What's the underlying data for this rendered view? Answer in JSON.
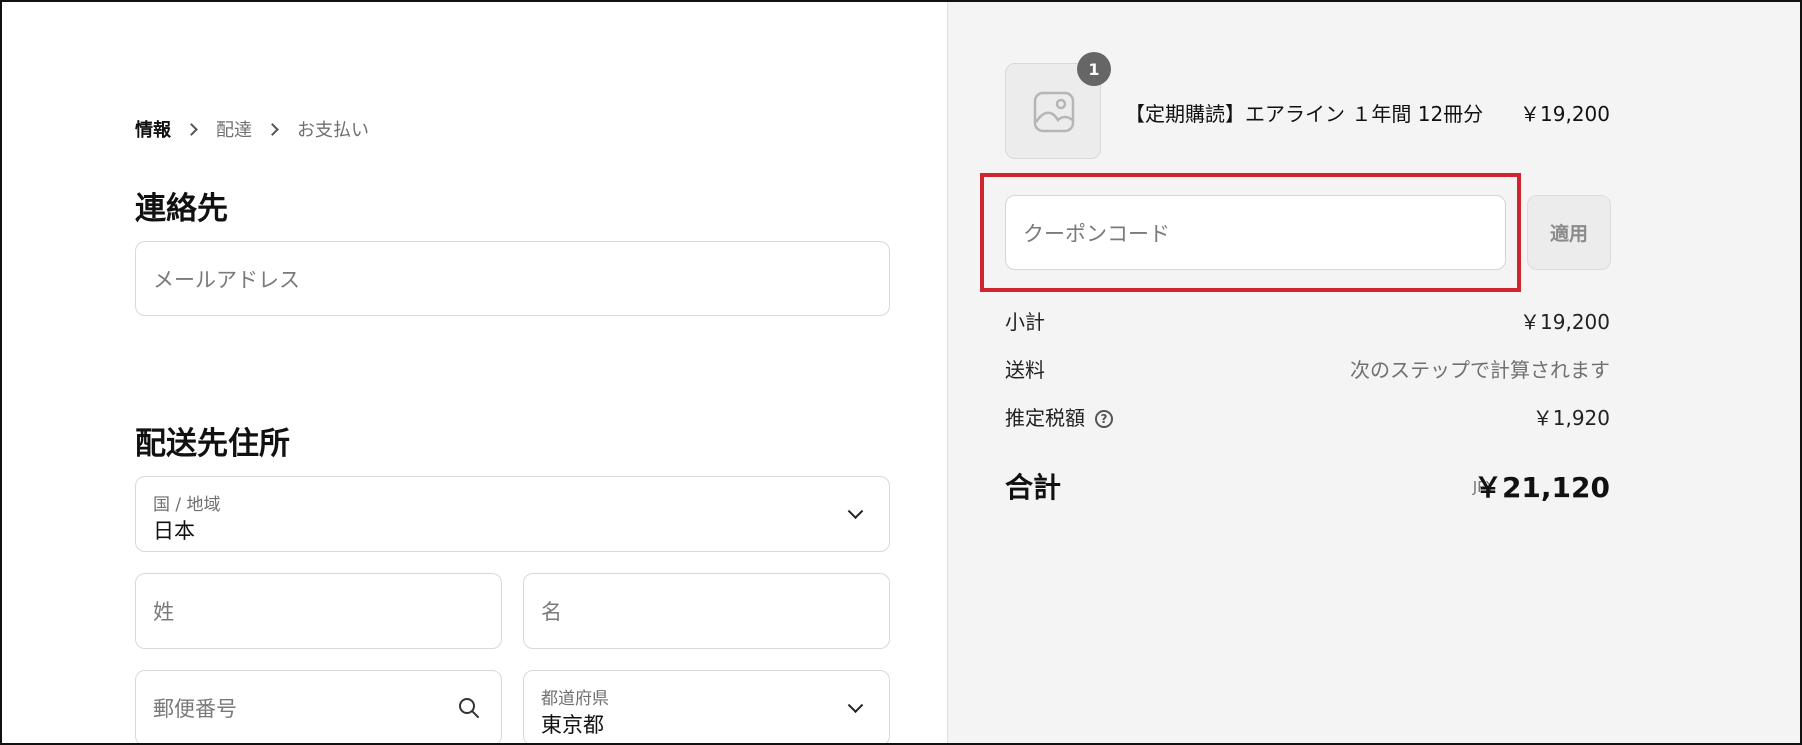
{
  "breadcrumb": {
    "items": [
      "情報",
      "配達",
      "お支払い"
    ]
  },
  "contact": {
    "title": "連絡先",
    "email_placeholder": "メールアドレス"
  },
  "shipping": {
    "title": "配送先住所",
    "country_label": "国 / 地域",
    "country_value": "日本",
    "last_name_placeholder": "姓",
    "first_name_placeholder": "名",
    "postal_placeholder": "郵便番号",
    "prefecture_label": "都道府県",
    "prefecture_value": "東京都"
  },
  "cart": {
    "item_count": "1",
    "product_name": "【定期購読】エアライン １年間 12冊分",
    "product_price": "￥19,200"
  },
  "coupon": {
    "placeholder": "クーポンコード",
    "apply_label": "適用"
  },
  "summary": {
    "subtotal_label": "小計",
    "subtotal_value": "￥19,200",
    "shipping_label": "送料",
    "shipping_value": "次のステップで計算されます",
    "tax_label": "推定税額",
    "tax_value": "￥1,920",
    "total_label": "合計",
    "total_currency": "JPY",
    "total_value": "￥21,120"
  },
  "colors": {
    "highlight": "#d1242f",
    "sidebar_bg": "#f4f4f4"
  }
}
